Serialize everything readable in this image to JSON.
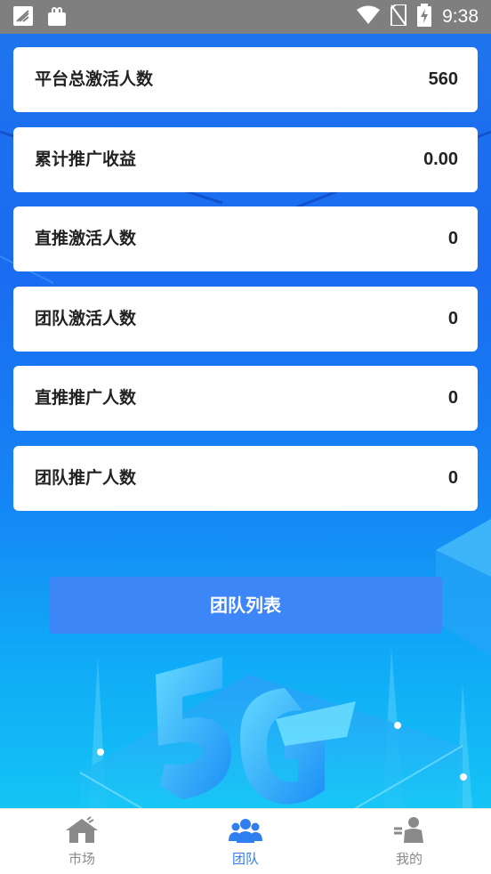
{
  "status_bar": {
    "time": "9:38"
  },
  "stats": [
    {
      "label": "平台总激活人数",
      "value": "560"
    },
    {
      "label": "累计推广收益",
      "value": "0.00"
    },
    {
      "label": "直推激活人数",
      "value": "0"
    },
    {
      "label": "团队激活人数",
      "value": "0"
    },
    {
      "label": "直推推广人数",
      "value": "0"
    },
    {
      "label": "团队推广人数",
      "value": "0"
    }
  ],
  "team_list_button": "团队列表",
  "tabbar": {
    "items": [
      {
        "label": "市场",
        "icon": "house-icon",
        "active": false
      },
      {
        "label": "团队",
        "icon": "team-icon",
        "active": true
      },
      {
        "label": "我的",
        "icon": "person-icon",
        "active": false
      }
    ]
  },
  "colors": {
    "status_bar": "#7f7f7f",
    "background_top": "#1e74ef",
    "background_bottom": "#14c4f5",
    "button": "#3d86f7",
    "tab_active": "#2f7ff0",
    "tab_inactive": "#8a8a8a"
  }
}
